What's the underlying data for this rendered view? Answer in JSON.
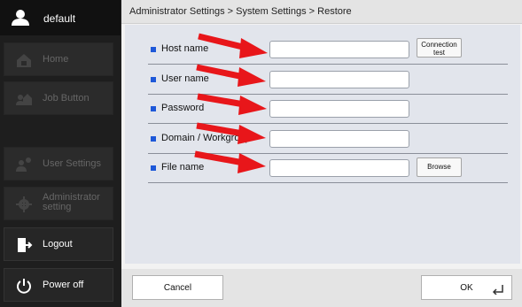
{
  "user": {
    "name": "default"
  },
  "nav": [
    {
      "label": "Home",
      "icon": "home-icon",
      "active": false
    },
    {
      "label": "Job Button",
      "icon": "job-button-icon",
      "active": false
    },
    {
      "label": "User Settings",
      "icon": "user-settings-icon",
      "active": false
    },
    {
      "label": "Administrator setting",
      "line1": "Administrator",
      "line2": "setting",
      "icon": "gear-icon",
      "active": false
    },
    {
      "label": "Logout",
      "icon": "logout-icon",
      "active": true
    },
    {
      "label": "Power off",
      "icon": "power-icon",
      "active": true
    }
  ],
  "breadcrumb": "Administrator Settings > System Settings > Restore",
  "form": {
    "fields": [
      {
        "label": "Host name",
        "value": "",
        "button": "Connection test",
        "button_line1": "Connection",
        "button_line2": "test"
      },
      {
        "label": "User name",
        "value": ""
      },
      {
        "label": "Password",
        "value": ""
      },
      {
        "label": "Domain / Workgroup",
        "value": ""
      },
      {
        "label": "File name",
        "value": "",
        "button": "Browse"
      }
    ]
  },
  "footer": {
    "cancel": "Cancel",
    "ok": "OK"
  },
  "colors": {
    "bullet": "#1e58d8",
    "arrow": "#e8161a",
    "panel": "#e2e5ec"
  }
}
